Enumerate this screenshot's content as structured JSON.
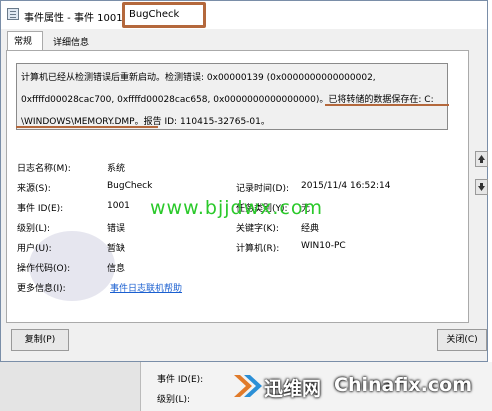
{
  "window": {
    "title": "事件属性 - 事件 1001",
    "title_suffix": "BugCheck"
  },
  "tabs": [
    {
      "label": "常规",
      "active": true
    },
    {
      "label": "详细信息",
      "active": false
    }
  ],
  "description": {
    "line1": "计算机已经从检测错误后重新启动。检测错误: 0x00000139 (0x0000000000000002,",
    "line2": "0xffffd00028cac700, 0xffffd00028cac658, 0x0000000000000000)。已将转储的数据保存在: C:",
    "line3": "\\WINDOWS\\MEMORY.DMP。报告 ID: 110415-32765-01。"
  },
  "fields": {
    "log_name": {
      "label": "日志名称(M):",
      "value": "系统"
    },
    "source": {
      "label": "来源(S):",
      "value": "BugCheck"
    },
    "logged": {
      "label": "记录时间(D):",
      "value": "2015/11/4 16:52:14"
    },
    "event_id": {
      "label": "事件 ID(E):",
      "value": "1001"
    },
    "task_category": {
      "label": "任务类别(Y):",
      "value": "无"
    },
    "level": {
      "label": "级别(L):",
      "value": "错误"
    },
    "keywords": {
      "label": "关键字(K):",
      "value": "经典"
    },
    "user": {
      "label": "用户(U):",
      "value": "暂缺"
    },
    "computer": {
      "label": "计算机(R):",
      "value": "WIN10-PC"
    },
    "opcode": {
      "label": "操作代码(O):",
      "value": "信息"
    },
    "more_info": {
      "label": "更多信息(I):",
      "link": "事件日志联机帮助"
    }
  },
  "watermark": "www.bjjdwx.com",
  "buttons": {
    "copy": "复制(P)",
    "close": "关闭(C)"
  },
  "background_panel": {
    "event_id_label": "事件 ID(E):",
    "level_label": "级别(L):"
  },
  "brand": {
    "cn": "迅维网",
    "en": "Chinafix.com"
  },
  "colors": {
    "annotation": "#b4683c",
    "link": "#1a5fd0",
    "watermark": "#2ac92a"
  }
}
